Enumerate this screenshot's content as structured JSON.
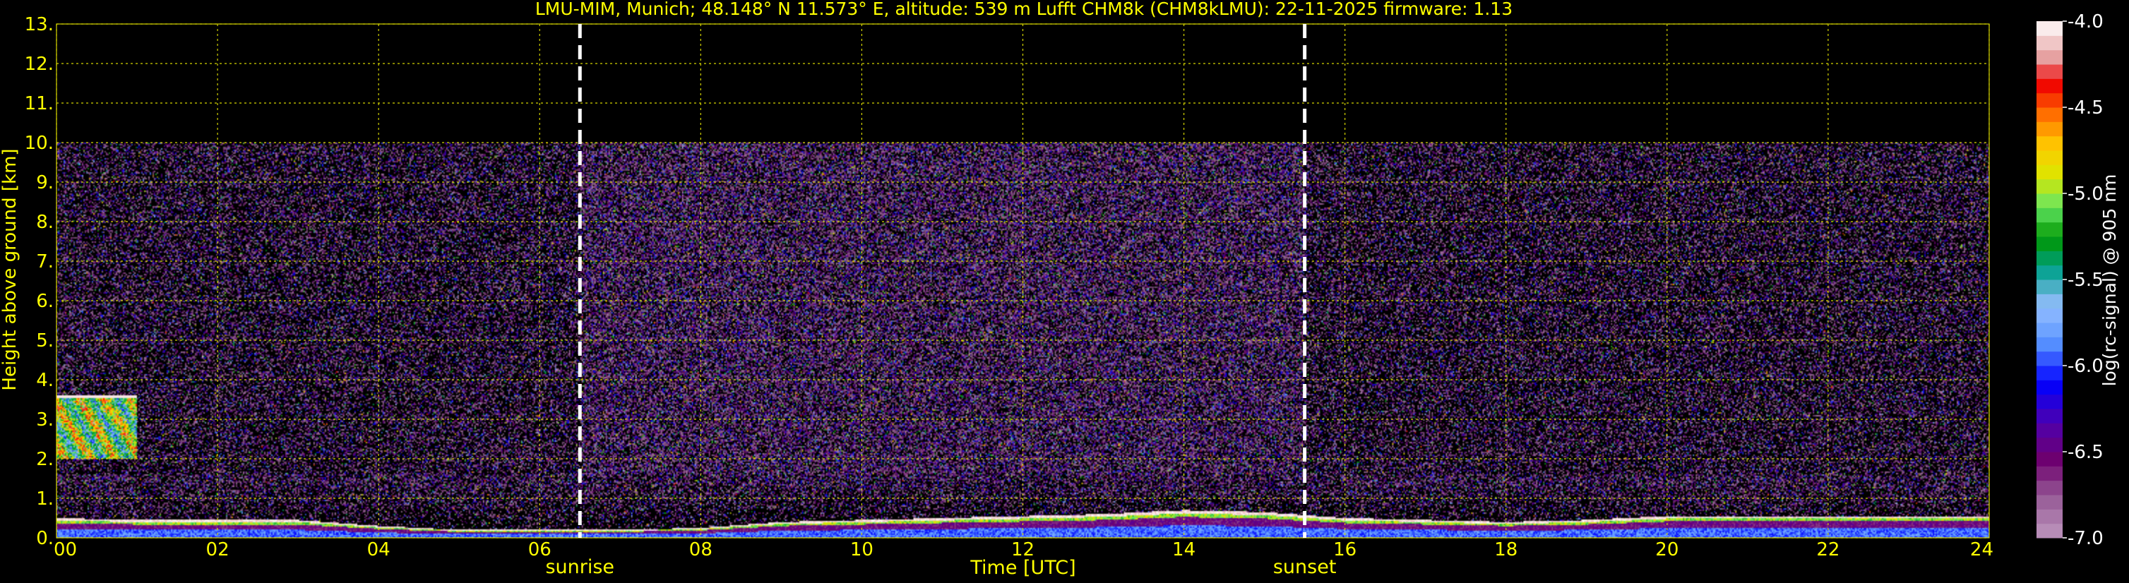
{
  "chart_data": {
    "type": "heatmap",
    "title": "LMU-MIM, Munich; 48.148° N 11.573° E, altitude: 539 m    Lufft CHM8k (CHM8kLMU): 22-11-2025    firmware: 1.13",
    "xlabel": "Time [UTC]",
    "ylabel": "Height above ground [km]",
    "colorbar_label": "log(rc-signal) @ 905 nm",
    "xlim": [
      0,
      24
    ],
    "ylim": [
      0,
      13
    ],
    "x_ticks": [
      "00",
      "02",
      "04",
      "06",
      "08",
      "10",
      "12",
      "14",
      "16",
      "18",
      "20",
      "22",
      "24"
    ],
    "y_ticks": [
      "0.",
      "1.",
      "2.",
      "3.",
      "4.",
      "5.",
      "6.",
      "7.",
      "8.",
      "9.",
      "10.",
      "11.",
      "12.",
      "13."
    ],
    "colorbar_ticks": [
      "-4.0",
      "-4.5",
      "-5.0",
      "-5.5",
      "-6.0",
      "-6.5",
      "-7.0"
    ],
    "colorbar_range": [
      -7.0,
      -4.0
    ],
    "grid": true,
    "grid_color": "#d4d400",
    "text_color": "#ffff00",
    "background": "#000000",
    "data_top_km": 10.0,
    "annotations": [
      {
        "label": "sunrise",
        "x": 6.5
      },
      {
        "label": "sunset",
        "x": 15.5
      }
    ],
    "boundary_layer_top_km": [
      {
        "x": 0.0,
        "y": 0.5
      },
      {
        "x": 1.0,
        "y": 0.45
      },
      {
        "x": 2.0,
        "y": 0.45
      },
      {
        "x": 3.0,
        "y": 0.45
      },
      {
        "x": 4.0,
        "y": 0.3
      },
      {
        "x": 5.0,
        "y": 0.2
      },
      {
        "x": 6.0,
        "y": 0.2
      },
      {
        "x": 7.0,
        "y": 0.2
      },
      {
        "x": 8.0,
        "y": 0.25
      },
      {
        "x": 9.0,
        "y": 0.4
      },
      {
        "x": 10.0,
        "y": 0.45
      },
      {
        "x": 11.0,
        "y": 0.5
      },
      {
        "x": 12.0,
        "y": 0.55
      },
      {
        "x": 13.0,
        "y": 0.6
      },
      {
        "x": 14.0,
        "y": 0.7
      },
      {
        "x": 15.0,
        "y": 0.65
      },
      {
        "x": 16.0,
        "y": 0.5
      },
      {
        "x": 17.0,
        "y": 0.45
      },
      {
        "x": 18.0,
        "y": 0.4
      },
      {
        "x": 19.0,
        "y": 0.45
      },
      {
        "x": 20.0,
        "y": 0.55
      },
      {
        "x": 21.0,
        "y": 0.55
      },
      {
        "x": 22.0,
        "y": 0.55
      },
      {
        "x": 23.0,
        "y": 0.55
      },
      {
        "x": 24.0,
        "y": 0.55
      }
    ],
    "cloud_layers": [
      {
        "x_start": 0.0,
        "x_end": 1.0,
        "y_base": 2.0,
        "y_top": 3.6
      }
    ]
  }
}
